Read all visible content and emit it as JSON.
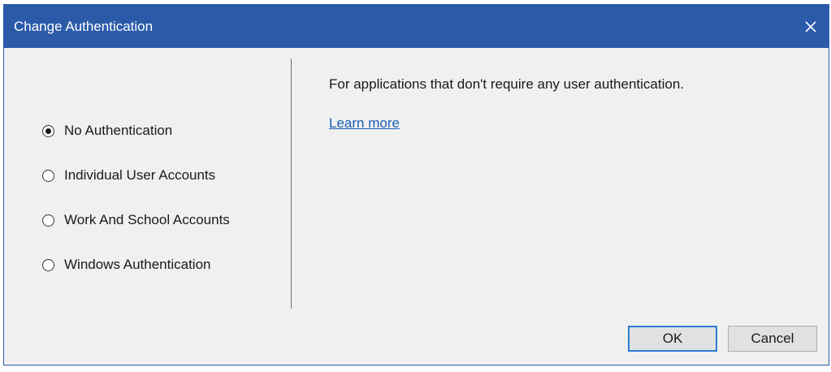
{
  "window": {
    "title": "Change Authentication",
    "titlebar_color": "#2b5aa9"
  },
  "auth_options": [
    {
      "label": "No Authentication",
      "selected": true
    },
    {
      "label": "Individual User Accounts",
      "selected": false
    },
    {
      "label": "Work And School Accounts",
      "selected": false
    },
    {
      "label": "Windows Authentication",
      "selected": false
    }
  ],
  "details": {
    "description": "For applications that don't require any user authentication.",
    "learn_more_label": "Learn more",
    "link_color": "#1a5fb4"
  },
  "buttons": {
    "ok_label": "OK",
    "cancel_label": "Cancel"
  },
  "icons": {
    "close": "close-icon"
  }
}
